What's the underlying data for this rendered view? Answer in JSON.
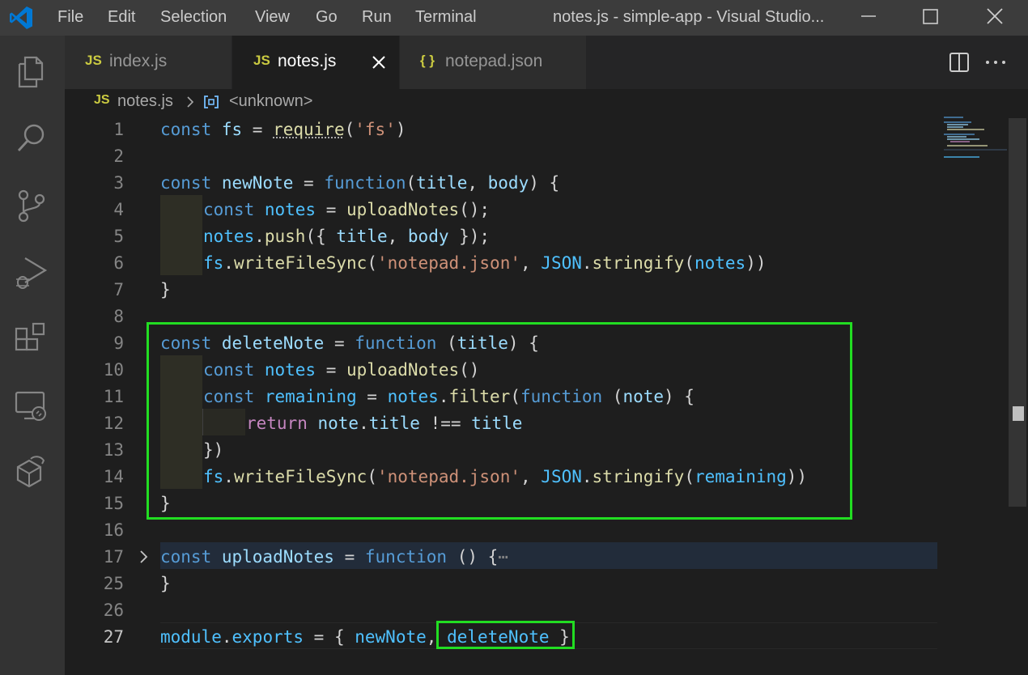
{
  "menu": [
    "File",
    "Edit",
    "Selection",
    "View",
    "Go",
    "Run",
    "Terminal"
  ],
  "window_title": "notes.js - simple-app - Visual Studio...",
  "tabs": [
    {
      "icon": "JS",
      "label": "index.js",
      "active": false
    },
    {
      "icon": "JS",
      "label": "notes.js",
      "active": true
    },
    {
      "icon": "{ }",
      "label": "notepad.json",
      "active": false
    }
  ],
  "breadcrumb": {
    "icon": "JS",
    "file": "notes.js",
    "symbol": "<unknown>"
  },
  "code": {
    "l1": {
      "n": "1",
      "a": "const",
      "b": " fs ",
      "c": "= ",
      "d": "require",
      "e": "(",
      "f": "'fs'",
      "g": ")"
    },
    "l2": {
      "n": "2"
    },
    "l3": {
      "n": "3",
      "a": "const",
      "b": " newNote ",
      "c": "= ",
      "d": "function",
      "e": "(",
      "f": "title",
      "g": ", ",
      "h": "body",
      "i": ") {"
    },
    "l4": {
      "n": "4",
      "a": "const",
      "b": " notes ",
      "c": "= ",
      "d": "uploadNotes",
      "e": "();"
    },
    "l5": {
      "n": "5",
      "a": "notes",
      "b": ".",
      "c": "push",
      "d": "({ ",
      "e": "title",
      "f": ", ",
      "g": "body",
      "h": " });"
    },
    "l6": {
      "n": "6",
      "a": "fs",
      "b": ".",
      "c": "writeFileSync",
      "d": "(",
      "e": "'notepad.json'",
      "f": ", ",
      "g": "JSON",
      "h": ".",
      "i": "stringify",
      "j": "(",
      "k": "notes",
      "l": "))"
    },
    "l7": {
      "n": "7",
      "a": "}"
    },
    "l8": {
      "n": "8"
    },
    "l9": {
      "n": "9",
      "a": "const",
      "b": " deleteNote ",
      "c": "= ",
      "d": "function",
      "e": " (",
      "f": "title",
      "g": ") {"
    },
    "l10": {
      "n": "10",
      "a": "const",
      "b": " notes ",
      "c": "= ",
      "d": "uploadNotes",
      "e": "()"
    },
    "l11": {
      "n": "11",
      "a": "const",
      "b": " remaining ",
      "c": "= ",
      "d": "notes",
      "e": ".",
      "f": "filter",
      "g": "(",
      "h": "function",
      "i": " (",
      "j": "note",
      "k": ") {"
    },
    "l12": {
      "n": "12",
      "a": "return",
      "b": " note",
      "c": ".",
      "d": "title",
      "e": " !== ",
      "f": "title"
    },
    "l13": {
      "n": "13",
      "a": "})"
    },
    "l14": {
      "n": "14",
      "a": "fs",
      "b": ".",
      "c": "writeFileSync",
      "d": "(",
      "e": "'notepad.json'",
      "f": ", ",
      "g": "JSON",
      "h": ".",
      "i": "stringify",
      "j": "(",
      "k": "remaining",
      "l": "))"
    },
    "l15": {
      "n": "15",
      "a": "}"
    },
    "l16": {
      "n": "16"
    },
    "l17": {
      "n": "17",
      "a": "const",
      "b": " uploadNotes ",
      "c": "= ",
      "d": "function",
      "e": " () {",
      "f": "⋯"
    },
    "l25": {
      "n": "25",
      "a": "}"
    },
    "l26": {
      "n": "26"
    },
    "l27": {
      "n": "27",
      "a": "module",
      "b": ".",
      "c": "exports",
      "d": " = { ",
      "e": "newNote",
      "f": ", ",
      "g": "deleteNote",
      "h": " }"
    }
  },
  "colors": {
    "highlight_box": "#22dd22",
    "accent": "#007acc",
    "keyword": "#569cd6",
    "function": "#dcdcaa",
    "string": "#ce9178"
  }
}
